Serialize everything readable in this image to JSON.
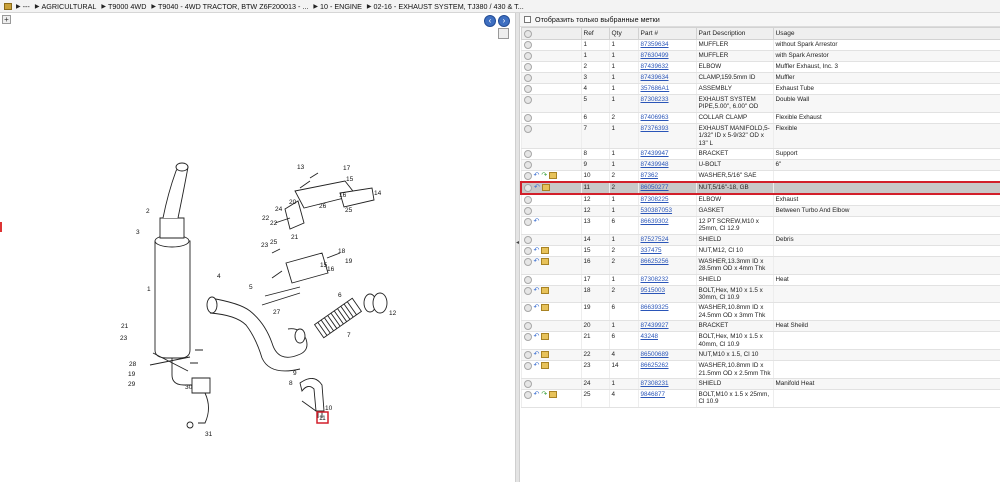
{
  "breadcrumb": [
    "---",
    "AGRICULTURAL",
    "T9000 4WD",
    "T9040 - 4WD TRACTOR, BTW Z6F200013 - ...",
    "10 - ENGINE",
    "02-16 - EXHAUST SYSTEM, TJ380 / 430 & T..."
  ],
  "filter": {
    "label": "Отобразить только выбранные метки"
  },
  "columns": [
    "Ref",
    "Qty",
    "Part #",
    "Part Description",
    "Usage"
  ],
  "rows": [
    {
      "ref": "1",
      "qty": "1",
      "part": "87359634",
      "desc": "MUFFLER",
      "usage": "without Spark Arrestor",
      "icons": []
    },
    {
      "ref": "1",
      "qty": "1",
      "part": "87630499",
      "desc": "MUFFLER",
      "usage": "with Spark Arrestor",
      "icons": []
    },
    {
      "ref": "2",
      "qty": "1",
      "part": "87439632",
      "desc": "ELBOW",
      "usage": "Muffler Exhaust, Inc. 3",
      "icons": []
    },
    {
      "ref": "3",
      "qty": "1",
      "part": "87439634",
      "desc": "CLAMP,159.5mm ID",
      "usage": "Muffler",
      "icons": []
    },
    {
      "ref": "4",
      "qty": "1",
      "part": "357686A1",
      "desc": "ASSEMBLY",
      "usage": "Exhaust Tube",
      "icons": []
    },
    {
      "ref": "5",
      "qty": "1",
      "part": "87308233",
      "desc": "EXHAUST SYSTEM PIPE,5.00\", 6.00\" OD",
      "usage": "Double Wall",
      "icons": []
    },
    {
      "ref": "6",
      "qty": "2",
      "part": "87406963",
      "desc": "COLLAR CLAMP",
      "usage": "Flexible Exhaust",
      "icons": []
    },
    {
      "ref": "7",
      "qty": "1",
      "part": "87376393",
      "desc": "EXHAUST MANIFOLD,5-1/32\" ID x 5-9/32\" OD x 13\" L",
      "usage": "Flexible",
      "icons": []
    },
    {
      "ref": "8",
      "qty": "1",
      "part": "87439947",
      "desc": "BRACKET",
      "usage": "Support",
      "icons": []
    },
    {
      "ref": "9",
      "qty": "1",
      "part": "87439948",
      "desc": "U-BOLT",
      "usage": "6\"",
      "icons": []
    },
    {
      "ref": "10",
      "qty": "2",
      "part": "87362",
      "desc": "WASHER,5/16\" SAE",
      "usage": "",
      "icons": [
        "undo",
        "redo",
        "box"
      ]
    },
    {
      "ref": "11",
      "qty": "2",
      "part": "86050277",
      "desc": "NUT,5/16\"-18, GB",
      "usage": "",
      "icons": [
        "undo",
        "box"
      ],
      "selected": true
    },
    {
      "ref": "12",
      "qty": "1",
      "part": "87308225",
      "desc": "ELBOW",
      "usage": "Exhaust",
      "icons": []
    },
    {
      "ref": "12",
      "qty": "1",
      "part": "530387053",
      "desc": "GASKET",
      "usage": "Between Turbo And Elbow",
      "icons": []
    },
    {
      "ref": "13",
      "qty": "6",
      "part": "86639302",
      "desc": "12 PT SCREW,M10 x 25mm, Cl 12.9",
      "usage": "",
      "icons": [
        "undo"
      ]
    },
    {
      "ref": "14",
      "qty": "1",
      "part": "87527524",
      "desc": "SHIELD",
      "usage": "Debris",
      "icons": []
    },
    {
      "ref": "15",
      "qty": "2",
      "part": "337475",
      "desc": "NUT,M12, Cl 10",
      "usage": "",
      "icons": [
        "undo",
        "box"
      ]
    },
    {
      "ref": "16",
      "qty": "2",
      "part": "86625256",
      "desc": "WASHER,13.3mm ID x 28.5mm OD x 4mm Thk",
      "usage": "",
      "icons": [
        "undo",
        "box"
      ]
    },
    {
      "ref": "17",
      "qty": "1",
      "part": "87308232",
      "desc": "SHIELD",
      "usage": "Heat",
      "icons": []
    },
    {
      "ref": "18",
      "qty": "2",
      "part": "9515003",
      "desc": "BOLT,Hex, M10 x 1.5 x 30mm, Cl 10.9",
      "usage": "",
      "icons": [
        "undo",
        "box"
      ]
    },
    {
      "ref": "19",
      "qty": "6",
      "part": "86639325",
      "desc": "WASHER,10.8mm ID x 24.5mm OD x 3mm Thk",
      "usage": "",
      "icons": [
        "undo",
        "box"
      ]
    },
    {
      "ref": "20",
      "qty": "1",
      "part": "87439927",
      "desc": "BRACKET",
      "usage": "Heat Sheild",
      "icons": []
    },
    {
      "ref": "21",
      "qty": "6",
      "part": "43248",
      "desc": "BOLT,Hex, M10 x 1.5 x 40mm, Cl 10.9",
      "usage": "",
      "icons": [
        "undo",
        "box"
      ]
    },
    {
      "ref": "22",
      "qty": "4",
      "part": "86500689",
      "desc": "NUT,M10 x 1.5, Cl 10",
      "usage": "",
      "icons": [
        "undo",
        "box"
      ]
    },
    {
      "ref": "23",
      "qty": "14",
      "part": "86625262",
      "desc": "WASHER,10.8mm ID x 21.5mm OD x 2.5mm Thk",
      "usage": "",
      "icons": [
        "undo",
        "box"
      ]
    },
    {
      "ref": "24",
      "qty": "1",
      "part": "87308231",
      "desc": "SHIELD",
      "usage": "Manifold Heat",
      "icons": []
    },
    {
      "ref": "25",
      "qty": "4",
      "part": "9846877",
      "desc": "BOLT,M10 x 1.5 x 25mm, Cl 10.9",
      "usage": "",
      "icons": [
        "undo",
        "redo",
        "box"
      ]
    }
  ],
  "diagram": {
    "callouts": [
      "1",
      "2",
      "3",
      "4",
      "5",
      "6",
      "7",
      "8",
      "9",
      "10",
      "11",
      "12",
      "13",
      "14",
      "15",
      "16",
      "17",
      "18",
      "19",
      "20",
      "21",
      "22",
      "23",
      "24",
      "25",
      "26",
      "27",
      "28",
      "29",
      "30",
      "31"
    ],
    "highlighted": "11"
  }
}
